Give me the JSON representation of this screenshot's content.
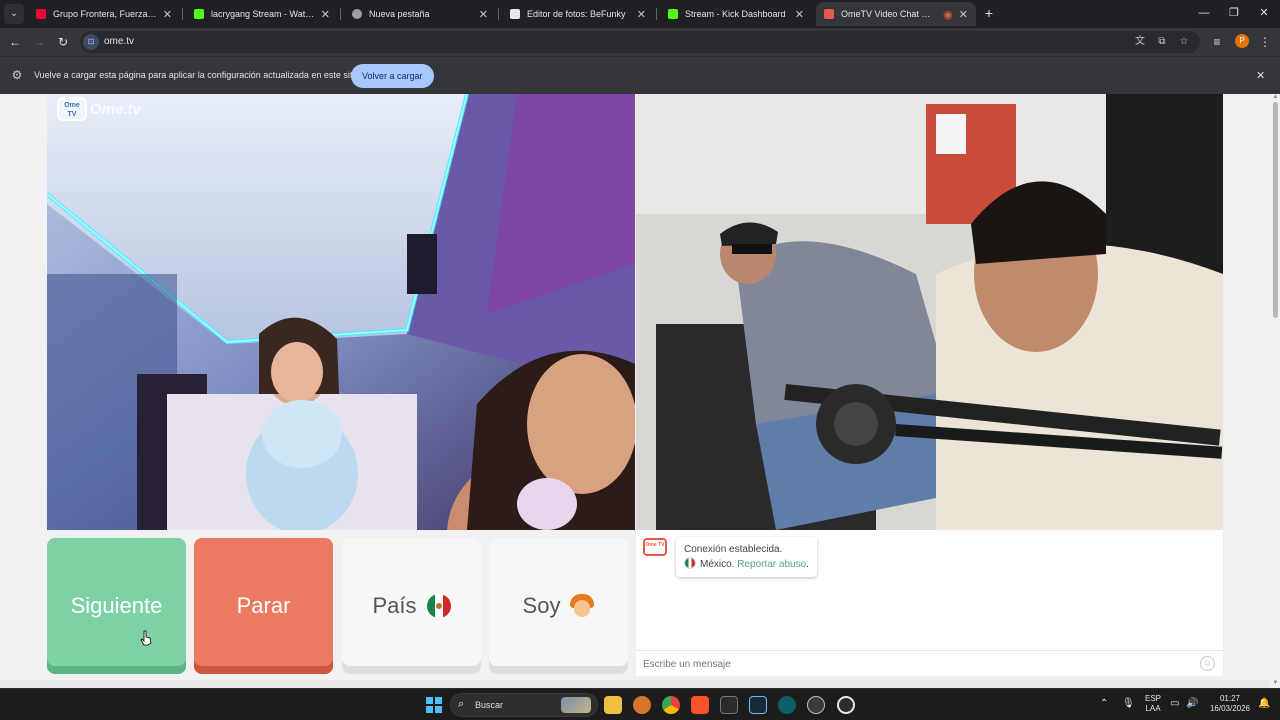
{
  "browser": {
    "tabs": [
      {
        "title": "Grupo Frontera, Fuerza Regida",
        "favicon_color": "#ff0033",
        "favicon_icon": "youtube-icon",
        "active": false
      },
      {
        "title": "lacrygang Stream - Watch Live",
        "favicon_color": "#53fc18",
        "favicon_icon": "kick-icon",
        "active": false
      },
      {
        "title": "Nueva pestaña",
        "favicon_color": "#9aa0a6",
        "favicon_icon": "chrome-icon",
        "active": false
      },
      {
        "title": "Editor de fotos: BeFunky",
        "favicon_color": "#e8e8e8",
        "favicon_icon": "befunky-icon",
        "active": false
      },
      {
        "title": "Stream - Kick Dashboard",
        "favicon_color": "#53fc18",
        "favicon_icon": "kick-icon",
        "active": false
      },
      {
        "title": "OmeTV Video Chat — Ome",
        "favicon_color": "#e55a4b",
        "favicon_icon": "ometv-icon",
        "active": true
      }
    ],
    "url": "ome.tv",
    "infobar": {
      "message": "Vuelve a cargar esta página para aplicar la configuración actualizada en este sitio",
      "button": "Volver a cargar"
    },
    "profile_initial": "P"
  },
  "page": {
    "logo_badge": "Ome TV",
    "logo_text": "Ome.tv",
    "buttons": {
      "next": "Siguiente",
      "stop": "Parar",
      "country": "País",
      "gender": "Soy"
    },
    "chat": {
      "logo": "Ome TV",
      "status": "Conexión establecida.",
      "country": "México.",
      "report": "Reportar abuso",
      "report_suffix": ".",
      "placeholder": "Escribe un mensaje"
    }
  },
  "taskbar": {
    "search_label": "Buscar",
    "language": "ESP",
    "layout": "LAA",
    "time": "01:27",
    "date": "16/03/2026"
  },
  "colors": {
    "next_button": "#7ed1a4",
    "stop_button": "#ec7a62",
    "infobar_button": "#a8c7fa"
  }
}
